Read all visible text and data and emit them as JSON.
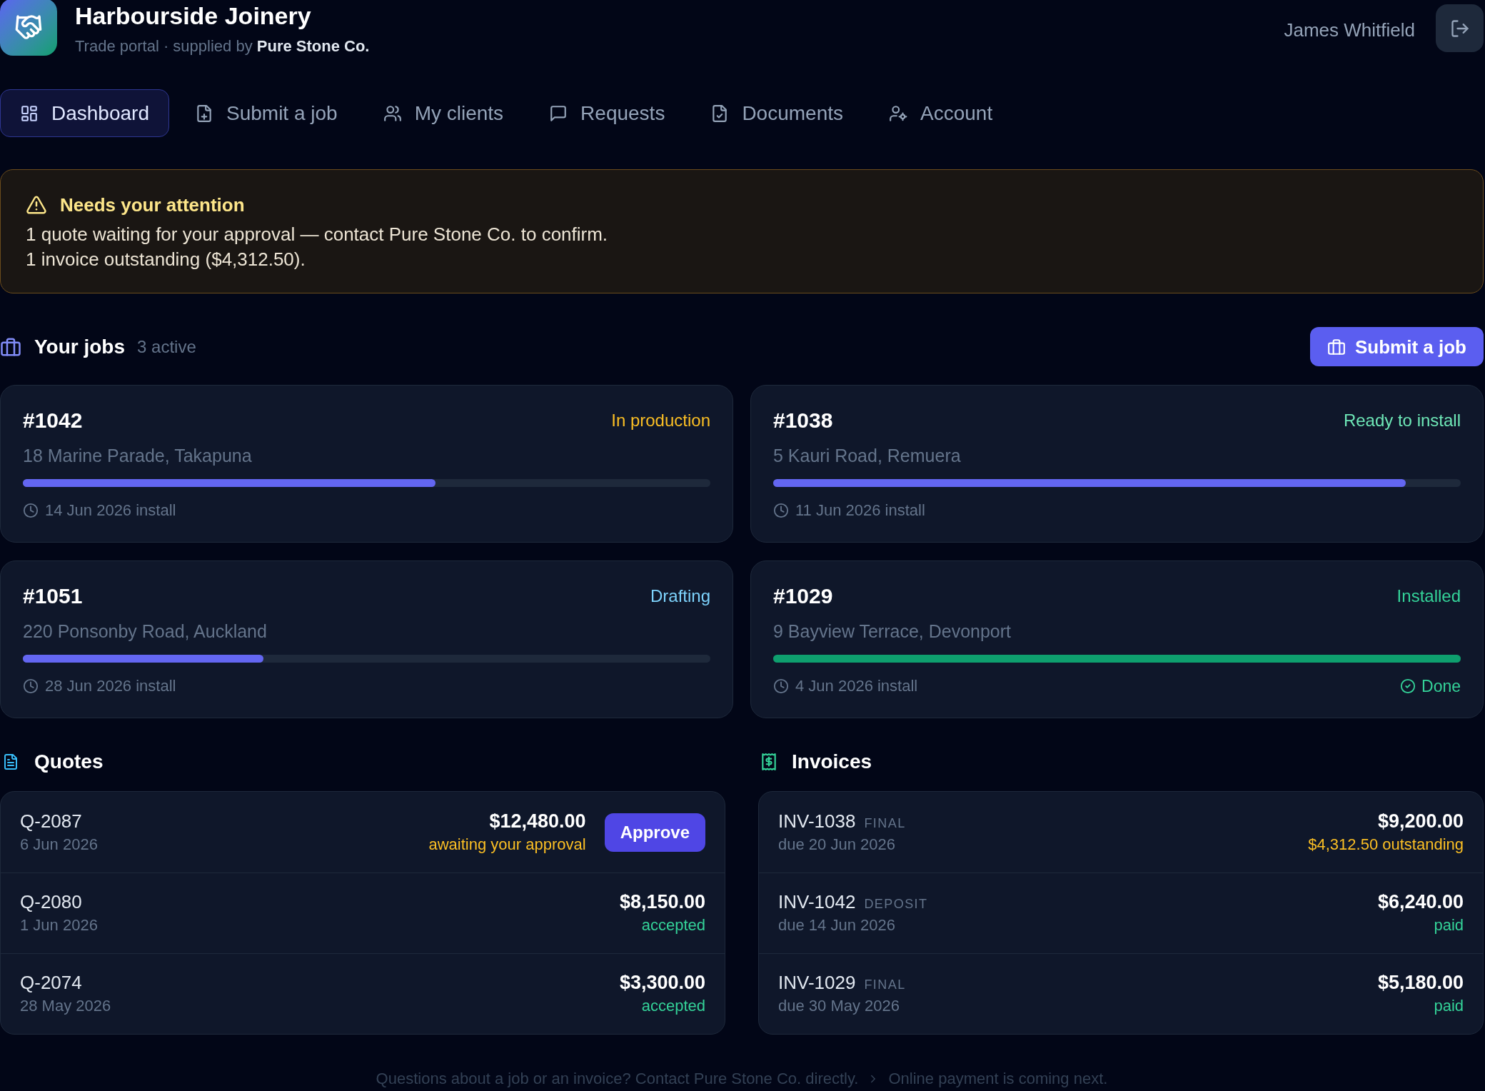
{
  "header": {
    "brand": "Harbourside Joinery",
    "tagline": "Trade portal · supplied by **Pure Stone Co.**",
    "user": "James Whitfield"
  },
  "nav": {
    "tabs": [
      {
        "label": "Dashboard",
        "selected": true
      },
      {
        "label": "Submit a job",
        "selected": false
      },
      {
        "label": "My clients",
        "selected": false
      },
      {
        "label": "Requests",
        "selected": false
      },
      {
        "label": "Documents",
        "selected": false
      },
      {
        "label": "Account",
        "selected": false
      }
    ]
  },
  "alert": {
    "title": "Needs your attention",
    "lines": [
      "1 quote waiting for your approval — contact Pure Stone Co. to confirm.",
      "1 invoice outstanding ($4,312.50)."
    ]
  },
  "jobs": {
    "title": "Your jobs",
    "count": "3 active",
    "submit_button": "Submit a job",
    "items": [
      {
        "number": "#1042",
        "status": "In production",
        "color": "#fbbf24",
        "address": "18 Marine Parade, Takapuna",
        "level": 0.6,
        "install": "14 Jun 2026 install",
        "completed": false
      },
      {
        "number": "#1038",
        "status": "Ready to install",
        "color": "#6ee7b7",
        "address": "5 Kauri Road, Remuera",
        "level": 0.92,
        "install": "11 Jun 2026 install",
        "completed": false
      },
      {
        "number": "#1051",
        "status": "Drafting",
        "color": "#7dd3fc",
        "address": "220 Ponsonby Road, Auckland",
        "level": 0.35,
        "install": "28 Jun 2026 install",
        "completed": false
      },
      {
        "number": "#1029",
        "status": "Installed",
        "color": "#34d399",
        "address": "9 Bayview Terrace, Devonport",
        "level": 1,
        "install": "4 Jun 2026 install",
        "completed": true,
        "completed_label": "Done"
      }
    ]
  },
  "quotes": {
    "title": "Quotes",
    "rows": [
      {
        "id": "Q-2087",
        "date": "6 Jun 2026",
        "amount": "$12,480.00",
        "status": "awaiting your approval",
        "color": "#fbbf24",
        "action": "Approve"
      },
      {
        "id": "Q-2080",
        "date": "1 Jun 2026",
        "amount": "$8,150.00",
        "status": "accepted",
        "color": "#34d399"
      },
      {
        "id": "Q-2074",
        "date": "28 May 2026",
        "amount": "$3,300.00",
        "status": "accepted",
        "color": "#34d399"
      }
    ]
  },
  "invoices": {
    "title": "Invoices",
    "rows": [
      {
        "id": "INV-1038",
        "type": "FINAL",
        "due": "due 20 Jun 2026",
        "amount": "$9,200.00",
        "status": "$4,312.50 outstanding",
        "color": "#fbbf24"
      },
      {
        "id": "INV-1042",
        "type": "DEPOSIT",
        "due": "due 14 Jun 2026",
        "amount": "$6,240.00",
        "status": "paid",
        "color": "#34d399"
      },
      {
        "id": "INV-1029",
        "type": "FINAL",
        "due": "due 30 May 2026",
        "amount": "$5,180.00",
        "status": "paid",
        "color": "#34d399"
      }
    ]
  },
  "footer": {
    "note": "Questions about a job or an invoice? Contact Pure Stone Co. directly.",
    "next": "Online payment is coming next."
  }
}
